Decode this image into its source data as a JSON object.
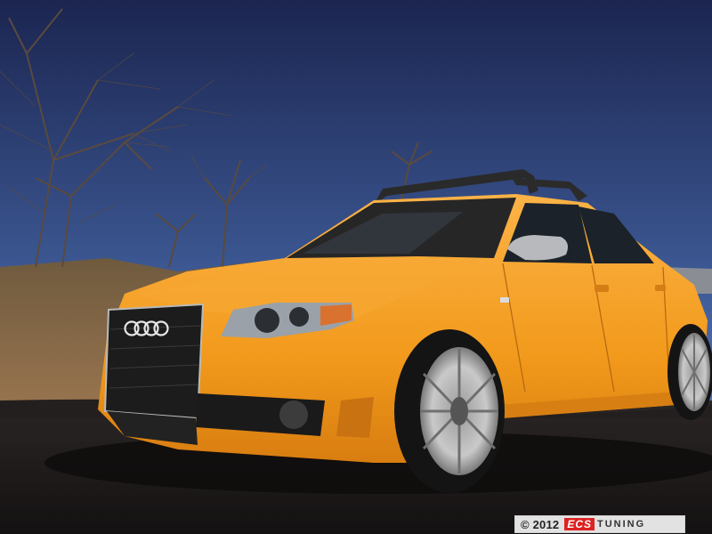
{
  "watermark": {
    "copyright": "© 2012",
    "brand_primary": "ECS",
    "brand_secondary": "TUNING"
  },
  "colors": {
    "sky_top": "#1d2a52",
    "sky_bottom": "#5f7eb6",
    "car_body": "#f39a1f",
    "ground": "#1f1b1b",
    "grass": "#8a6a45"
  }
}
